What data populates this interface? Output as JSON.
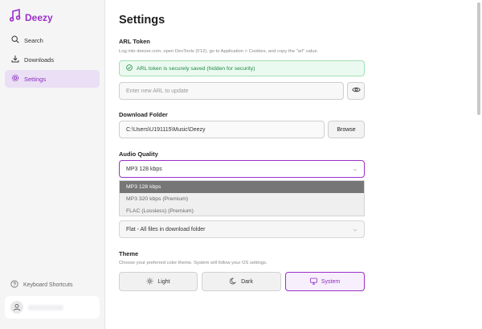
{
  "app": {
    "name": "Deezy"
  },
  "sidebar": {
    "items": [
      {
        "label": "Search",
        "icon": "search-icon"
      },
      {
        "label": "Downloads",
        "icon": "download-icon"
      },
      {
        "label": "Settings",
        "icon": "gear-icon",
        "active": true
      }
    ],
    "shortcuts_label": "Keyboard Shortcuts"
  },
  "main": {
    "title": "Settings",
    "arl": {
      "label": "ARL Token",
      "help": "Log into deezer.com, open DevTools (F12), go to Application > Cookies, and copy the \"arl\" value.",
      "status": "ARL token is securely saved (hidden for security)",
      "placeholder": "Enter new ARL to update"
    },
    "download_folder": {
      "label": "Download Folder",
      "value": "C:\\Users\\U191115\\Music\\Deezy",
      "browse_label": "Browse"
    },
    "audio_quality": {
      "label": "Audio Quality",
      "selected": "MP3 128 kbps",
      "options": [
        "MP3 128 kbps",
        "MP3 320 kbps (Premium)",
        "FLAC (Lossless) (Premium)"
      ]
    },
    "folder_structure": {
      "selected": "Flat - All files in download folder"
    },
    "theme": {
      "label": "Theme",
      "help": "Choose your preferred color theme. System will follow your OS settings.",
      "options": [
        "Light",
        "Dark",
        "System"
      ],
      "selected": "System"
    }
  },
  "colors": {
    "accent": "#9b30c8",
    "success": "#1d8a44",
    "sidebar_bg": "#f5f5f6"
  }
}
